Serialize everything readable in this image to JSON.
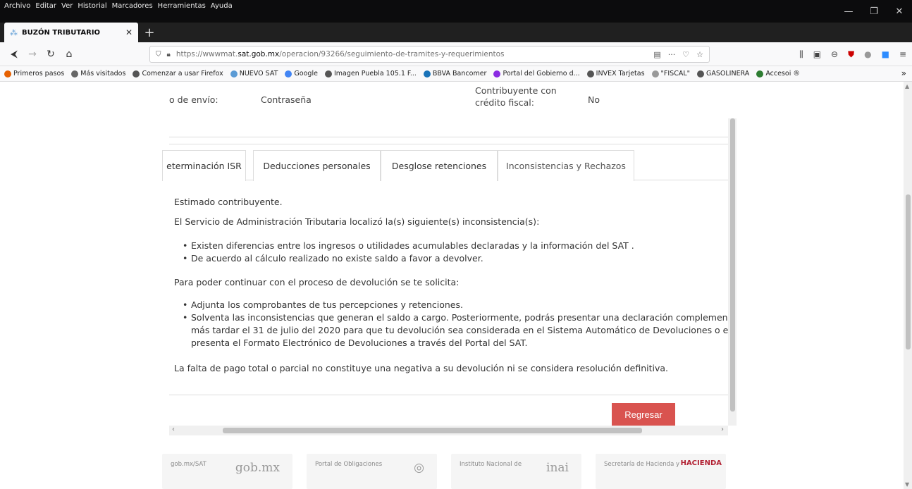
{
  "browser": {
    "menu": [
      "Archivo",
      "Editar",
      "Ver",
      "Historial",
      "Marcadores",
      "Herramientas",
      "Ayuda"
    ],
    "tab_title": "BUZÓN TRIBUTARIO",
    "url_prefix": "https://wwwmat.",
    "url_domain": "sat.gob.mx",
    "url_path": "/operacion/93266/seguimiento-de-tramites-y-requerimientos",
    "bookmarks": [
      {
        "label": "Primeros pasos",
        "color": "#e66000"
      },
      {
        "label": "Más visitados",
        "color": "#666666"
      },
      {
        "label": "Comenzar a usar Firefox",
        "color": "#555555"
      },
      {
        "label": "NUEVO SAT",
        "color": "#5b9bd5"
      },
      {
        "label": "Google",
        "color": "#4285f4"
      },
      {
        "label": "Imagen Puebla 105.1 F...",
        "color": "#555555"
      },
      {
        "label": "BBVA Bancomer",
        "color": "#1973b8"
      },
      {
        "label": "Portal del Gobierno d...",
        "color": "#8a2be2"
      },
      {
        "label": "INVEX Tarjetas",
        "color": "#555555"
      },
      {
        "label": "\"FISCAL\"",
        "color": "#999999"
      },
      {
        "label": "GASOLINERA",
        "color": "#555555"
      },
      {
        "label": "Accesoi ®",
        "color": "#2e7d32"
      }
    ]
  },
  "info": {
    "label1": "o de envío:",
    "value1": "Contraseña",
    "label2": "Contribuyente con crédito fiscal:",
    "value2": "No"
  },
  "tabs": [
    {
      "label": "eterminación ISR"
    },
    {
      "label": "Deducciones personales"
    },
    {
      "label": "Desglose retenciones"
    },
    {
      "label": "Inconsistencias y Rechazos"
    }
  ],
  "content": {
    "greeting": "Estimado contribuyente.",
    "intro": "El Servicio de Administración Tributaria localizó la(s) siguiente(s) inconsistencia(s):",
    "issues": [
      "Existen diferencias entre los ingresos o utilidades acumulables declaradas y la información del SAT .",
      "De acuerdo al cálculo realizado no existe saldo a favor a devolver."
    ],
    "request_intro": "Para poder continuar con el proceso de devolución se te solicita:",
    "requests_1": "Adjunta los comprobantes de tus percepciones y retenciones.",
    "requests_2a": "Solventa las inconsistencias que generan el saldo a cargo. Posteriormente, podrás presentar una declaración complement",
    "requests_2b": "más tardar el 31 de julio del 2020 para que tu devolución sea considerada en el Sistema Automático de Devoluciones o en",
    "requests_2c": "presenta el Formato Electrónico de Devoluciones a través del Portal del SAT.",
    "closing": "La falta de pago total o parcial no constituye una negativa a su devolución ni se considera resolución definitiva."
  },
  "back_button": "Regresar",
  "footer": [
    {
      "text": "gob.mx/SAT",
      "big": "gob.mx"
    },
    {
      "text": "Portal de Obligaciones",
      "big": "◎"
    },
    {
      "text": "Instituto Nacional de",
      "big": "inai"
    },
    {
      "text": "Secretaría de Hacienda y",
      "big": "HACIENDA"
    }
  ]
}
